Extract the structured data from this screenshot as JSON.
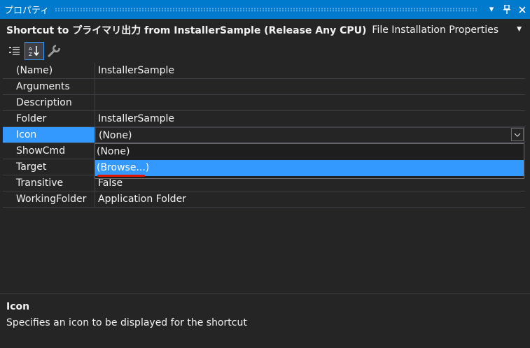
{
  "window": {
    "title": "プロパティ"
  },
  "object_selector": {
    "name": "Shortcut to プライマリ出力 from InstallerSample (Release Any CPU)",
    "type": "File Installation Properties"
  },
  "toolbar": {
    "icons": [
      "categorized-icon",
      "alphabetical-icon",
      "property-pages-icon"
    ]
  },
  "properties": [
    {
      "name": "(Name)",
      "value": "InstallerSample"
    },
    {
      "name": "Arguments",
      "value": ""
    },
    {
      "name": "Description",
      "value": ""
    },
    {
      "name": "Folder",
      "value": "InstallerSample"
    },
    {
      "name": "Icon",
      "value": "(None)"
    },
    {
      "name": "ShowCmd",
      "value": ""
    },
    {
      "name": "Target",
      "value": ""
    },
    {
      "name": "Transitive",
      "value": "False"
    },
    {
      "name": "WorkingFolder",
      "value": "Application Folder"
    }
  ],
  "selected_property": "Icon",
  "dropdown": {
    "options": [
      "(None)",
      "(Browse...)"
    ],
    "highlighted": "(Browse...)"
  },
  "description": {
    "title": "Icon",
    "text": "Specifies an icon to be displayed for the shortcut"
  },
  "colors": {
    "accent": "#007acc",
    "selection": "#3399ff",
    "background": "#252526",
    "annotation": "#e51400"
  }
}
